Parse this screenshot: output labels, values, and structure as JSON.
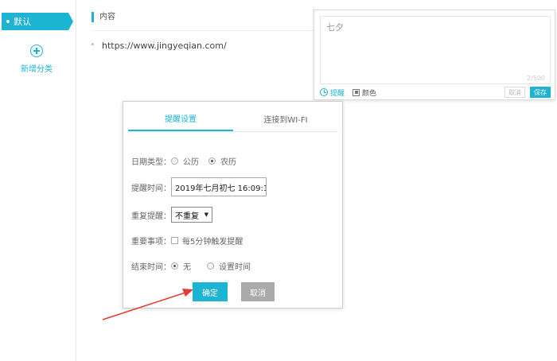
{
  "sidebar": {
    "active_item": "默认",
    "add_category": "新增分类"
  },
  "main": {
    "section_title": "内容",
    "items": [
      "https://www.jingyeqian.com/"
    ]
  },
  "editor": {
    "text": "七夕",
    "counter": "2/500",
    "remind_label": "提醒",
    "color_label": "颜色",
    "cancel_label": "取消",
    "save_label": "保存"
  },
  "dialog": {
    "tabs": [
      "提醒设置",
      "连接到WI-FI"
    ],
    "date_type_label": "日期类型：",
    "date_type_options": [
      "公历",
      "农历"
    ],
    "date_type_selected": "农历",
    "remind_time_label": "提醒时间：",
    "remind_time_value": "2019年七月初七 16:09:1:",
    "repeat_label": "重复提醒：",
    "repeat_value": "不重复",
    "important_label": "重要事项：",
    "important_option": "每5分钟触发提醒",
    "end_time_label": "结束时间：",
    "end_time_options": [
      "无",
      "设置时间"
    ],
    "end_time_selected": "无",
    "ok_label": "确定",
    "cancel_label": "取消"
  },
  "colors": {
    "accent": "#1db4d4",
    "annotation_arrow": "#e53935",
    "disabled_button": "#aaaaaa"
  }
}
